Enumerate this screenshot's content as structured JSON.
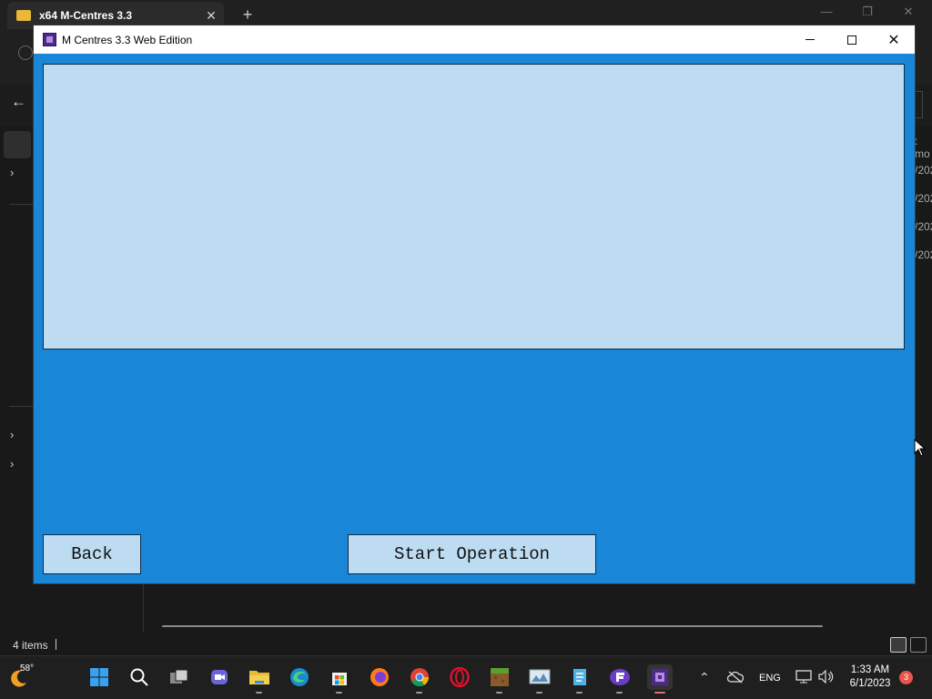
{
  "explorer": {
    "tab_title": "x64 M-Centres 3.3",
    "tab_close": "✕",
    "new_tab": "+",
    "list_fragments": [
      ": mo",
      "/202",
      "/202",
      "/202",
      "/202"
    ],
    "status_items": "4 items"
  },
  "app": {
    "title": "M Centres 3.3 Web Edition",
    "back_label": "Back",
    "start_label": "Start Operation",
    "close_glyph": "✕"
  },
  "taskbar": {
    "weather_temp": "58°",
    "apps": [
      "start-icon",
      "search-icon",
      "task-view-icon",
      "teams-chat-icon",
      "file-explorer-icon",
      "edge-icon",
      "store-icon",
      "firefox-icon",
      "chrome-icon",
      "opera-icon",
      "minecraft-icon",
      "photos-icon",
      "notepad-icon",
      "app-icon",
      "m-centres-icon"
    ],
    "language": "ENG",
    "time": "1:33 AM",
    "date": "6/1/2023",
    "notification_count": "3"
  },
  "colors": {
    "app_background": "#1a86d7",
    "panel_fill": "#bddcf2",
    "panel_border": "#0c2a4a"
  }
}
